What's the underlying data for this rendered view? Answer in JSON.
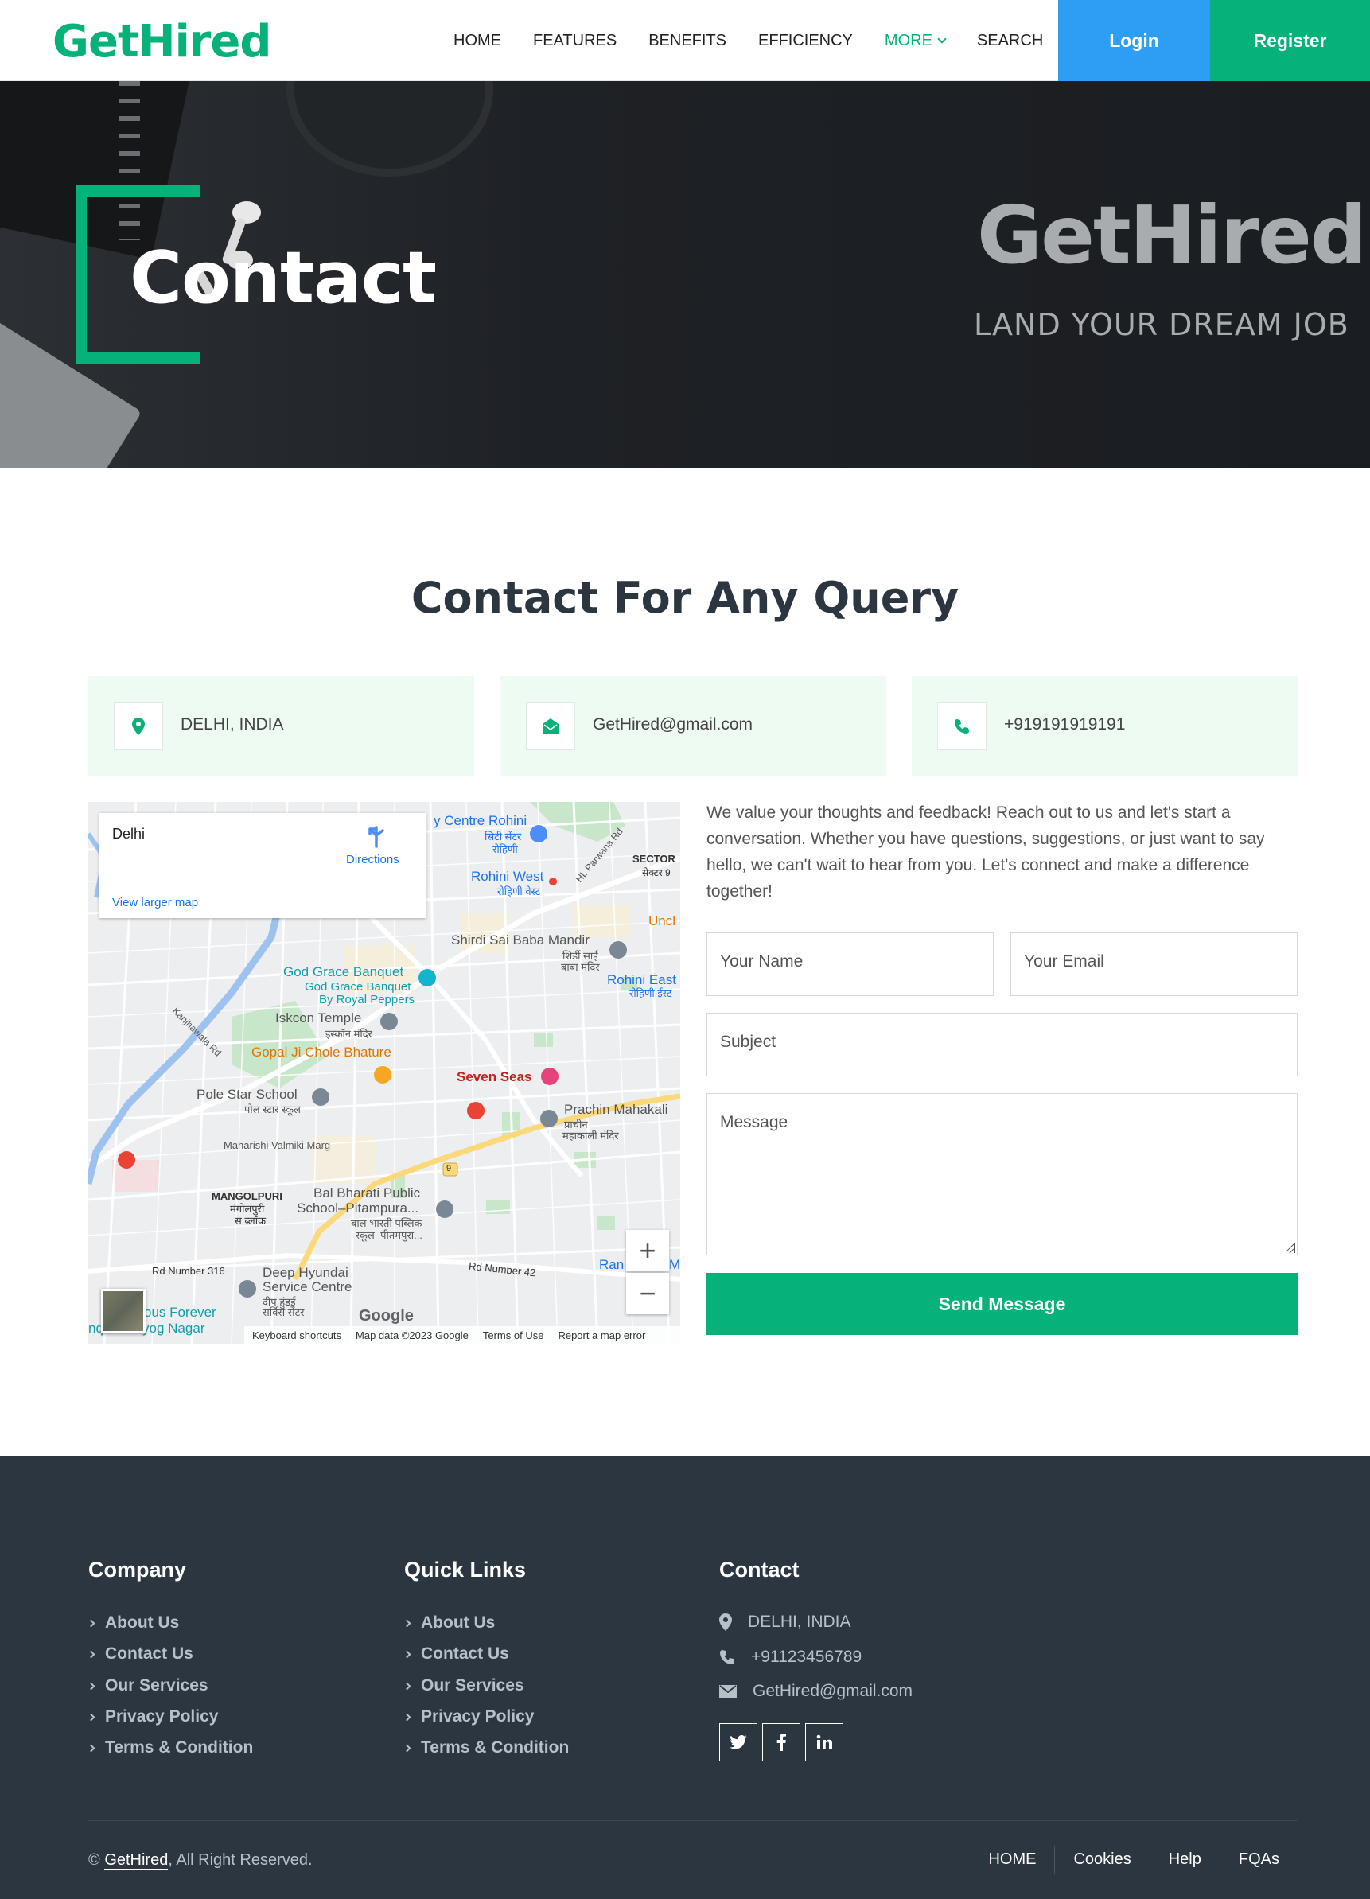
{
  "nav": {
    "brand": "GetHired",
    "links": [
      "HOME",
      "FEATURES",
      "BENEFITS",
      "EFFICIENCY",
      "MORE",
      "SEARCH"
    ],
    "login": "Login",
    "register": "Register",
    "accent": "#07b27a",
    "login_color": "#2e9df4"
  },
  "hero": {
    "title": "Contact",
    "brand": "GetHired",
    "tagline": "LAND YOUR DREAM JOB"
  },
  "contact": {
    "title": "Contact For Any Query",
    "info": [
      {
        "icon": "map-pin-icon",
        "text": "DELHI, INDIA"
      },
      {
        "icon": "envelope-open-icon",
        "text": "GetHired@gmail.com"
      },
      {
        "icon": "phone-icon",
        "text": "+919191919191"
      }
    ],
    "description": "We value your thoughts and feedback! Reach out to us and let's start a conversation. Whether you have questions, suggestions, or just want to say hello, we can't wait to hear from you. Let's connect and make a difference together!",
    "form": {
      "name_placeholder": "Your Name",
      "email_placeholder": "Your Email",
      "subject_placeholder": "Subject",
      "message_placeholder": "Message",
      "submit": "Send Message"
    }
  },
  "map": {
    "place": "Delhi",
    "directions": "Directions",
    "larger_map": "View larger map",
    "labels": {
      "centre_rohini": "y Centre Rohini",
      "centre_rohini_hi": "सिटी सेंटर",
      "rohini_hi2": "रोहिणी",
      "sector": "SECTOR",
      "sector_hi": "सेक्टर 9",
      "rohini_west": "Rohini West",
      "rohini_west_hi": "रोहिणी वेस्ट",
      "hl_pawana": "HL Parwana Rd",
      "uncl": "Uncl",
      "shirdi": "Shirdi Sai Baba Mandir",
      "shirdi_hi1": "शिर्डी साईं",
      "shirdi_hi2": "बाबा मंदिर",
      "rohini_east": "Rohini East",
      "rohini_east_hi": "रोहिणी ईस्ट",
      "god_grace": "God Grace Banquet",
      "god_grace2": "God Grace Banquet",
      "god_grace3": "By Royal Peppers",
      "iskcon": "Iskcon Temple",
      "iskcon_hi": "इस्कॉन मंदिर",
      "kanjhawala": "Kanjhawala Rd",
      "gopal": "Gopal Ji Chole Bhature",
      "seven_seas": "Seven Seas",
      "pole_star": "Pole Star School",
      "pole_star_hi": "पोल स्टार स्कूल",
      "prachin": "Prachin Mahakali",
      "prachin_hi1": "प्राचीन",
      "prachin_hi2": "महाकाली मंदिर",
      "valmiki": "Maharishi Valmiki Marg",
      "road9": "9",
      "mangolpuri": "MANGOLPURI",
      "mangolpuri_hi1": "मंगोलपुरी",
      "mangolpuri_hi2": "स ब्लॉक",
      "bal_bharati": "Bal Bharati Public",
      "bal_bharati2": "School–Pitampura...",
      "bal_bharati_hi1": "बाल भारती पब्लिक",
      "bal_bharati_hi2": "स्कूल–पीतमपुरा...",
      "rd316": "Rd Number 316",
      "rd42": "Rd Number 42",
      "deep": "Deep Hyundai",
      "deep2": "Service Centre",
      "deep_hi1": "दीप हुंडई",
      "deep_hi2": "सर्विस सेंटर",
      "ran": "Ran",
      "m": "M",
      "fous": "ous Forever",
      "udyog": "nquel Udyog Nagar"
    },
    "google": "Google",
    "footer_links": [
      "Keyboard shortcuts",
      "Map data ©2023 Google",
      "Terms of Use",
      "Report a map error"
    ]
  },
  "footer": {
    "company_title": "Company",
    "company_links": [
      "About Us",
      "Contact Us",
      "Our Services",
      "Privacy Policy",
      "Terms & Condition"
    ],
    "quick_title": "Quick Links",
    "quick_links": [
      "About Us",
      "Contact Us",
      "Our Services",
      "Privacy Policy",
      "Terms & Condition"
    ],
    "contact_title": "Contact",
    "address": "DELHI, INDIA",
    "phone": "+91123456789",
    "email": "GetHired@gmail.com",
    "social": [
      "twitter-icon",
      "facebook-icon",
      "linkedin-icon"
    ],
    "copyright_prefix": "©",
    "copyright_brand": "GetHired",
    "copyright_suffix": ", All Right Reserved.",
    "bottom_links": [
      "HOME",
      "Cookies",
      "Help",
      "FQAs"
    ],
    "background": "#2b3640"
  }
}
